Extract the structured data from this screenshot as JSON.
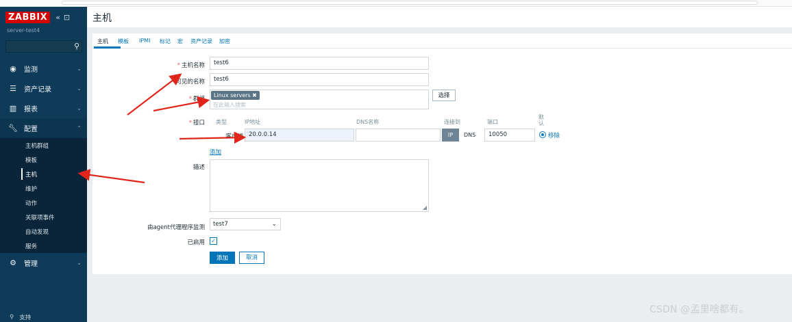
{
  "sidebar": {
    "logo": "ZABBIX",
    "collapse_glyph": "«",
    "kiosk_glyph": "⊡",
    "server_name": "server-test4",
    "menu": [
      {
        "label": "监测"
      },
      {
        "label": "资产记录"
      },
      {
        "label": "报表"
      },
      {
        "label": "配置"
      },
      {
        "label": "管理"
      }
    ],
    "submenu": [
      {
        "label": "主机群组"
      },
      {
        "label": "模板"
      },
      {
        "label": "主机"
      },
      {
        "label": "维护"
      },
      {
        "label": "动作"
      },
      {
        "label": "关联项事件"
      },
      {
        "label": "自动发现"
      },
      {
        "label": "服务"
      }
    ],
    "support": "支持"
  },
  "header": {
    "title": "主机"
  },
  "tabs": [
    "主机",
    "模板",
    "IPMI",
    "标记",
    "宏",
    "资产记录",
    "加密"
  ],
  "form": {
    "host_name_label": "主机名称",
    "host_name_value": "test6",
    "visible_name_label": "可见的名称",
    "visible_name_value": "test6",
    "groups_label": "群组",
    "group_chip": "Linux servers",
    "chip_remove": "✖",
    "groups_placeholder": "在此输入搜索",
    "select_button": "选择",
    "interfaces_label": "接口",
    "col_type": "类型",
    "col_ip": "IP地址",
    "col_dns": "DNS名称",
    "col_connect": "连接到",
    "col_port": "端口",
    "col_default": "默认",
    "iface_type": "客户端",
    "iface_ip": "20.0.0.14",
    "iface_dns": "",
    "btn_ip": "IP",
    "btn_dns": "DNS",
    "iface_port": "10050",
    "remove_link": "移除",
    "add_link": "添加",
    "description_label": "描述",
    "proxy_label": "由agent代理程序监测",
    "proxy_value": "test7",
    "enabled_label": "已启用",
    "add_button": "添加",
    "cancel_button": "取消"
  },
  "watermark": "CSDN @孟里啥都有。",
  "colors": {
    "sidebar": "#0e3c58",
    "logo_red": "#d40000",
    "accent_blue": "#0275b8",
    "annotation_arrow": "#e0261b"
  }
}
